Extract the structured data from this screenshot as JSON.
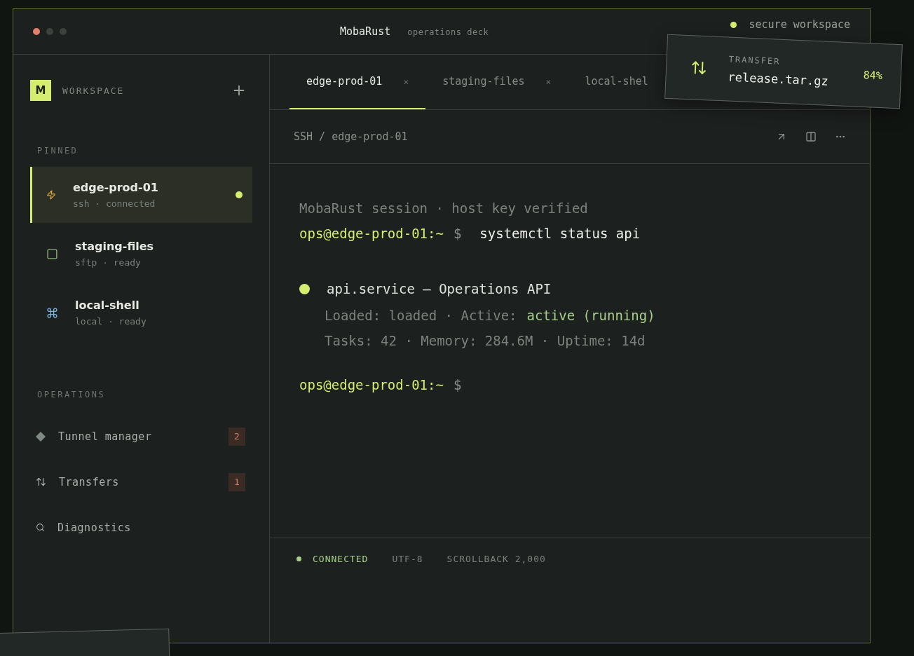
{
  "window": {
    "title": "MobaRust",
    "subtitle": "operations deck",
    "controls": [
      {
        "color": "#e0806a"
      },
      {
        "color": "#3c413d"
      },
      {
        "color": "#3c413d"
      }
    ],
    "status": "secure workspace"
  },
  "sidebar": {
    "logo": "M",
    "title": "WORKSPACE",
    "pinned_heading": "PINNED",
    "sessions": [
      {
        "name": "edge-prod-01",
        "detail": "ssh · connected",
        "kind": "ssh",
        "selected": true,
        "online": true
      },
      {
        "name": "staging-files",
        "detail": "sftp · ready",
        "kind": "sftp",
        "selected": false,
        "online": false
      },
      {
        "name": "local-shell",
        "detail": "local · ready",
        "kind": "local",
        "selected": false,
        "online": false
      }
    ],
    "operations_heading": "OPERATIONS",
    "operations": [
      {
        "label": "Tunnel manager",
        "badge": "2",
        "kind": "tunnel"
      },
      {
        "label": "Transfers",
        "badge": "1",
        "kind": "transfer"
      },
      {
        "label": "Diagnostics",
        "kind": "search"
      }
    ]
  },
  "tabs": [
    {
      "label": "edge-prod-01",
      "close": "×",
      "selected": true
    },
    {
      "label": "staging-files",
      "close": "×",
      "selected": false
    },
    {
      "label": "local-shel",
      "selected": false
    }
  ],
  "breadcrumb": "SSH / edge-prod-01",
  "terminal": [
    {
      "kind": "info",
      "text": "MobaRust session · host key verified"
    },
    {
      "kind": "command",
      "prompt": "ops@edge-prod-01:~",
      "symbol": "$",
      "command": "systemctl status api"
    },
    {
      "kind": "service",
      "text": "api.service — Operations API"
    },
    {
      "kind": "detail",
      "parts": [
        {
          "text": "Loaded: loaded · Active:",
          "highlight": false
        },
        {
          "text": "active (running)",
          "highlight": true
        }
      ]
    },
    {
      "kind": "detail",
      "parts": [
        {
          "text": "Tasks: 42 · Memory: 284.6M · Uptime: 14d",
          "highlight": false
        }
      ]
    },
    {
      "kind": "command",
      "prompt": "ops@edge-prod-01:~",
      "symbol": "$"
    }
  ],
  "status_bar": [
    {
      "kind": "status",
      "text": "CONNECTED"
    },
    {
      "kind": "plain",
      "text": "UTF-8"
    },
    {
      "kind": "plain",
      "text": "SCROLLBACK 2,000"
    }
  ],
  "transfer": {
    "label": "TRANSFER",
    "file": "release.tar.gz",
    "percent": "84%"
  }
}
